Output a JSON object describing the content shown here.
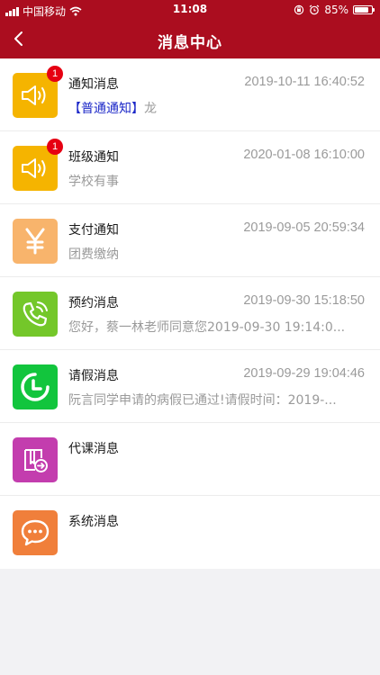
{
  "status_bar": {
    "carrier": "中国移动",
    "time": "11:08",
    "battery_percent": "85%",
    "battery_level": 0.85
  },
  "nav": {
    "title": "消息中心"
  },
  "colors": {
    "header": "#ab0d1f",
    "badge": "#e60012",
    "tag": "#1c28c8",
    "notice_icon": "#f5b400",
    "pay_icon": "#f8b46c",
    "appointment_icon": "#74c72a",
    "leave_icon": "#12c53d",
    "substitute_icon": "#c33dae",
    "system_icon": "#f07f3b"
  },
  "messages": [
    {
      "title": "通知消息",
      "time": "2019-10-11 16:40:52",
      "tag": "【普通通知】",
      "preview": "龙",
      "badge": "1",
      "icon": "speaker-icon"
    },
    {
      "title": "班级通知",
      "time": "2020-01-08 16:10:00",
      "preview": "学校有事",
      "badge": "1",
      "icon": "speaker-icon"
    },
    {
      "title": "支付通知",
      "time": "2019-09-05 20:59:34",
      "preview": "团费缴纳",
      "icon": "yen-icon"
    },
    {
      "title": "预约消息",
      "time": "2019-09-30 15:18:50",
      "preview": "您好，蔡一林老师同意您2019-09-30 19:14:0...",
      "icon": "phone-icon"
    },
    {
      "title": "请假消息",
      "time": "2019-09-29 19:04:46",
      "preview": "阮言同学申请的病假已通过!请假时间：2019-...",
      "icon": "clock-icon"
    },
    {
      "title": "代课消息",
      "icon": "substitute-icon"
    },
    {
      "title": "系统消息",
      "icon": "chat-bubble-icon"
    }
  ]
}
